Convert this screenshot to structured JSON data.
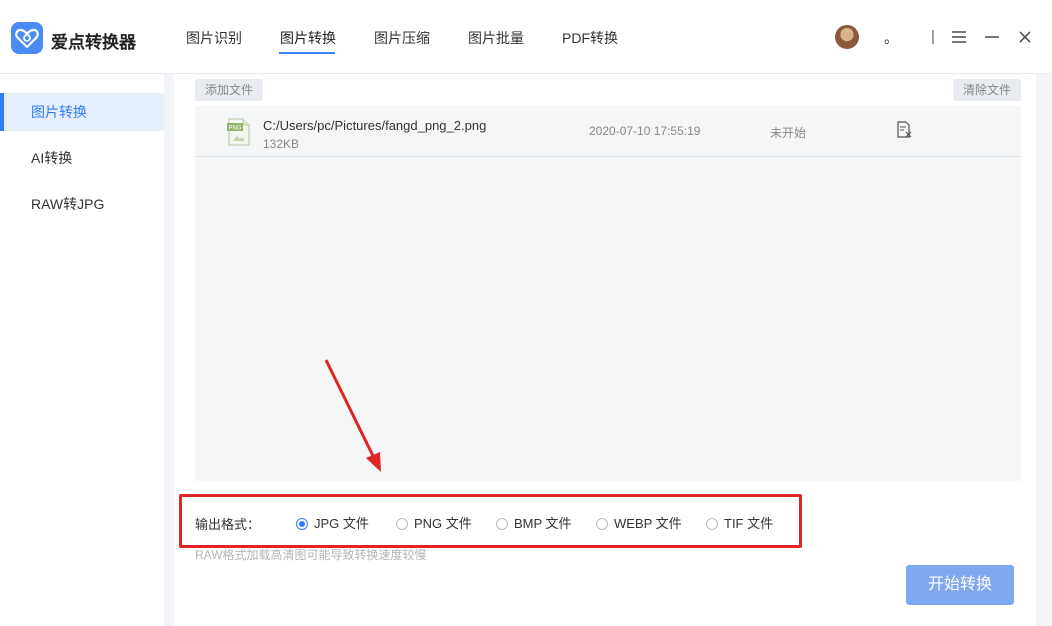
{
  "app": {
    "title": "爱点转换器"
  },
  "nav": {
    "tabs": [
      {
        "label": "图片识别"
      },
      {
        "label": "图片转换"
      },
      {
        "label": "图片压缩"
      },
      {
        "label": "图片批量"
      },
      {
        "label": "PDF转换"
      }
    ],
    "active_index": 1
  },
  "window_controls": {
    "dot": "。",
    "separator": "|"
  },
  "sidebar": {
    "items": [
      {
        "label": "图片转换",
        "active": true
      },
      {
        "label": "AI转换"
      },
      {
        "label": "RAW转JPG"
      }
    ]
  },
  "toolbar": {
    "add_label": "添加文件",
    "clear_label": "清除文件"
  },
  "files": [
    {
      "icon_text": "PNG",
      "path": "C:/Users/pc/Pictures/fangd_png_2.png",
      "size": "132KB",
      "date": "2020-07-10 17:55:19",
      "status": "未开始"
    }
  ],
  "output": {
    "label": "输出格式：",
    "options": [
      {
        "label": "JPG 文件",
        "checked": true
      },
      {
        "label": "PNG 文件"
      },
      {
        "label": "BMP 文件"
      },
      {
        "label": "WEBP 文件"
      },
      {
        "label": "TIF 文件"
      }
    ],
    "note": "RAW格式加载高清图可能导致转换速度较慢"
  },
  "start_button": {
    "label": "开始转换"
  },
  "colors": {
    "accent": "#2f7cf6",
    "highlight_box": "#e02424",
    "start_button": "#7fa8f0"
  }
}
